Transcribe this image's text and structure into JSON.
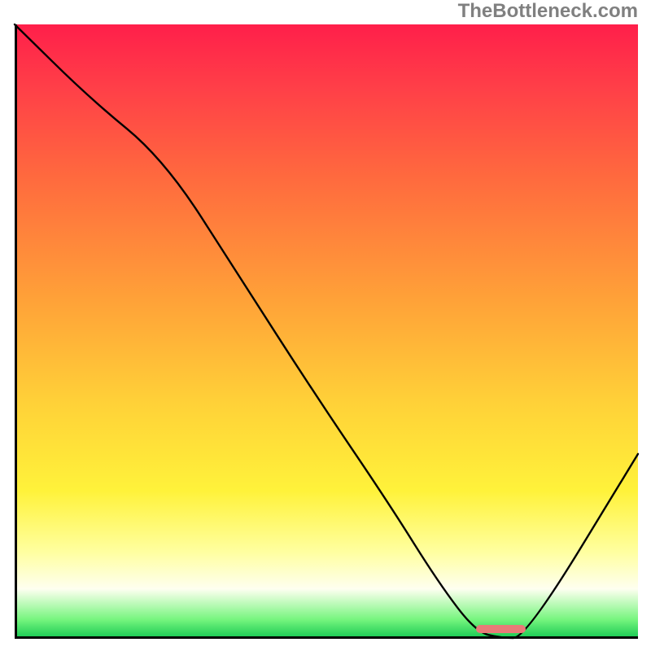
{
  "watermark": "TheBottleneck.com",
  "chart_data": {
    "type": "line",
    "title": "",
    "xlabel": "",
    "ylabel": "",
    "xlim": [
      0,
      100
    ],
    "ylim": [
      0,
      100
    ],
    "grid": false,
    "series": [
      {
        "name": "bottleneck-curve",
        "x": [
          0,
          12,
          24,
          36,
          48,
          60,
          68,
          74,
          78,
          82,
          100
        ],
        "values": [
          100,
          88,
          78,
          59,
          40,
          22,
          9,
          1,
          0,
          0,
          30
        ]
      }
    ],
    "annotation": {
      "name": "optimal-range",
      "x_start": 74,
      "x_end": 82,
      "y": 0,
      "color": "#e97a78"
    },
    "background_gradient": {
      "stops": [
        {
          "pos": 0.0,
          "color": "#ff1f4a"
        },
        {
          "pos": 0.1,
          "color": "#ff3e48"
        },
        {
          "pos": 0.25,
          "color": "#ff6a3e"
        },
        {
          "pos": 0.45,
          "color": "#ffa238"
        },
        {
          "pos": 0.62,
          "color": "#ffd238"
        },
        {
          "pos": 0.76,
          "color": "#fff23a"
        },
        {
          "pos": 0.86,
          "color": "#ffffa0"
        },
        {
          "pos": 0.92,
          "color": "#fefff0"
        },
        {
          "pos": 0.97,
          "color": "#76f57e"
        },
        {
          "pos": 1.0,
          "color": "#18c953"
        }
      ]
    }
  }
}
